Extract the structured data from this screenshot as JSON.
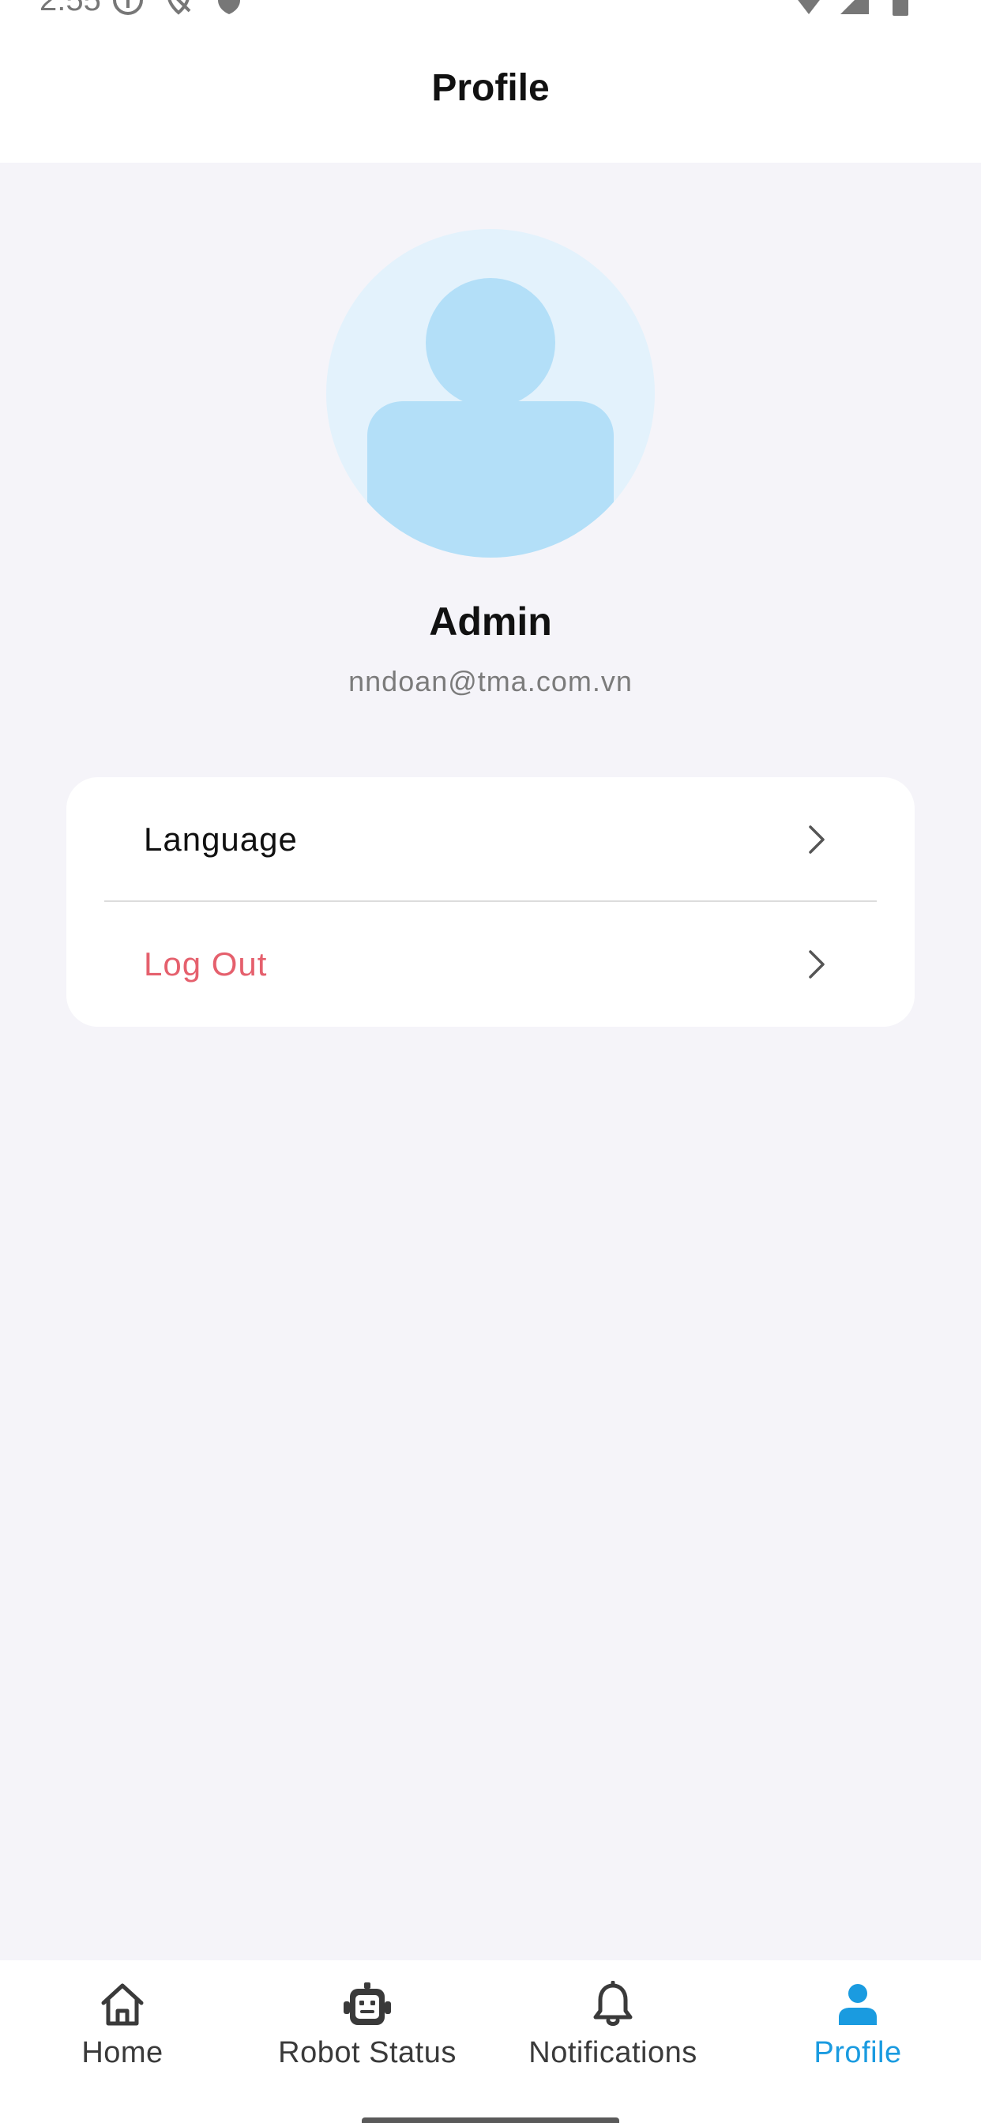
{
  "status_bar": {
    "time": "2:55",
    "left_icons": [
      "info-icon",
      "location-off-icon",
      "shield-icon"
    ],
    "right_icons": [
      "wifi-icon",
      "cellular-icon",
      "battery-icon"
    ]
  },
  "header": {
    "title": "Profile"
  },
  "profile": {
    "avatar_icon": "default-person-avatar",
    "name": "Admin",
    "email": "nndoan@tma.com.vn"
  },
  "settings": {
    "items": [
      {
        "label": "Language",
        "icon": "chevron-right-icon"
      },
      {
        "label": "Log Out",
        "icon": "chevron-right-icon",
        "color": "#e5606d"
      }
    ]
  },
  "bottom_nav": {
    "items": [
      {
        "label": "Home",
        "icon": "home-icon",
        "active": false
      },
      {
        "label": "Robot Status",
        "icon": "robot-icon",
        "active": false
      },
      {
        "label": "Notifications",
        "icon": "bell-icon",
        "active": false
      },
      {
        "label": "Profile",
        "icon": "person-icon",
        "active": true
      }
    ],
    "active_color": "#1a9be0",
    "inactive_color": "#3a3a3a"
  },
  "colors": {
    "background": "#f5f4f9",
    "avatar_bg": "#e3f2fc",
    "avatar_fg": "#b3dff8",
    "logout_text": "#e5606d"
  }
}
